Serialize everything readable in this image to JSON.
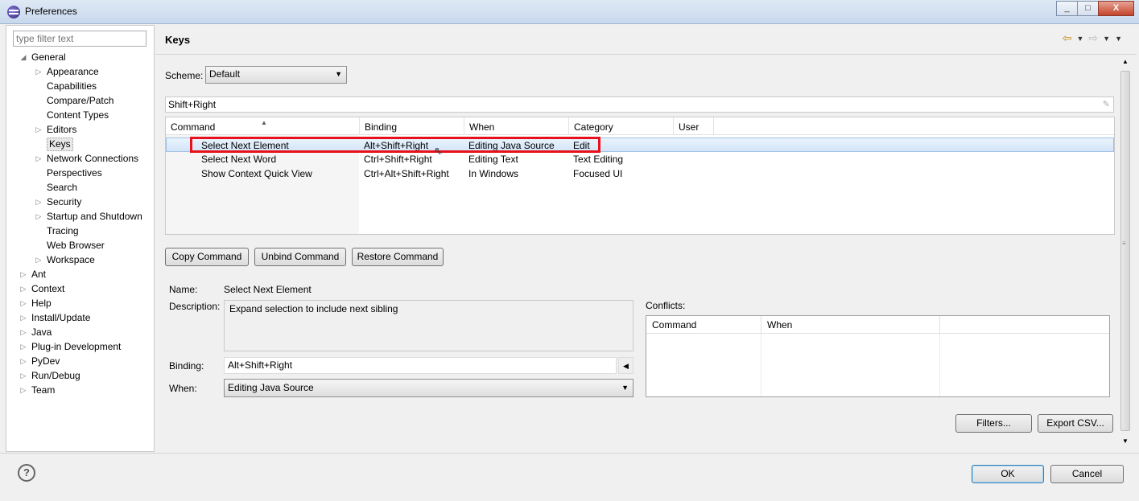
{
  "window": {
    "title": "Preferences",
    "min": "_",
    "max": "□",
    "close": "X"
  },
  "filter": {
    "placeholder": "type filter text"
  },
  "tree": [
    {
      "label": "General",
      "level": 0,
      "arrow": "◢"
    },
    {
      "label": "Appearance",
      "level": 1,
      "arrow": "▷"
    },
    {
      "label": "Capabilities",
      "level": 1,
      "arrow": ""
    },
    {
      "label": "Compare/Patch",
      "level": 1,
      "arrow": ""
    },
    {
      "label": "Content Types",
      "level": 1,
      "arrow": ""
    },
    {
      "label": "Editors",
      "level": 1,
      "arrow": "▷"
    },
    {
      "label": "Keys",
      "level": 1,
      "arrow": "",
      "selected": true
    },
    {
      "label": "Network Connections",
      "level": 1,
      "arrow": "▷"
    },
    {
      "label": "Perspectives",
      "level": 1,
      "arrow": ""
    },
    {
      "label": "Search",
      "level": 1,
      "arrow": ""
    },
    {
      "label": "Security",
      "level": 1,
      "arrow": "▷"
    },
    {
      "label": "Startup and Shutdown",
      "level": 1,
      "arrow": "▷"
    },
    {
      "label": "Tracing",
      "level": 1,
      "arrow": ""
    },
    {
      "label": "Web Browser",
      "level": 1,
      "arrow": ""
    },
    {
      "label": "Workspace",
      "level": 1,
      "arrow": "▷"
    },
    {
      "label": "Ant",
      "level": 0,
      "arrow": "▷"
    },
    {
      "label": "Context",
      "level": 0,
      "arrow": "▷"
    },
    {
      "label": "Help",
      "level": 0,
      "arrow": "▷"
    },
    {
      "label": "Install/Update",
      "level": 0,
      "arrow": "▷"
    },
    {
      "label": "Java",
      "level": 0,
      "arrow": "▷"
    },
    {
      "label": "Plug-in Development",
      "level": 0,
      "arrow": "▷"
    },
    {
      "label": "PyDev",
      "level": 0,
      "arrow": "▷"
    },
    {
      "label": "Run/Debug",
      "level": 0,
      "arrow": "▷"
    },
    {
      "label": "Team",
      "level": 0,
      "arrow": "▷"
    }
  ],
  "page": {
    "title": "Keys"
  },
  "scheme": {
    "label": "Scheme:",
    "value": "Default"
  },
  "search": {
    "value": "Shift+Right"
  },
  "table": {
    "columns": [
      "Command",
      "Binding",
      "When",
      "Category",
      "User"
    ],
    "rows": [
      {
        "command": "Select Next Element",
        "binding": "Alt+Shift+Right",
        "when": "Editing Java Source",
        "category": "Edit",
        "user": "",
        "selected": true
      },
      {
        "command": "Select Next Word",
        "binding": "Ctrl+Shift+Right",
        "when": "Editing Text",
        "category": "Text Editing",
        "user": ""
      },
      {
        "command": "Show Context Quick View",
        "binding": "Ctrl+Alt+Shift+Right",
        "when": "In Windows",
        "category": "Focused UI",
        "user": ""
      }
    ]
  },
  "buttons": {
    "copy": "Copy Command",
    "unbind": "Unbind Command",
    "restore": "Restore Command",
    "filters": "Filters...",
    "export": "Export CSV...",
    "ok": "OK",
    "cancel": "Cancel"
  },
  "details": {
    "name_label": "Name:",
    "name_value": "Select Next Element",
    "desc_label": "Description:",
    "desc_value": "Expand selection to include next sibling",
    "binding_label": "Binding:",
    "binding_value": "Alt+Shift+Right",
    "when_label": "When:",
    "when_value": "Editing Java Source"
  },
  "conflicts": {
    "label": "Conflicts:",
    "columns": [
      "Command",
      "When"
    ]
  },
  "help": {
    "glyph": "?"
  },
  "colors": {
    "highlight": "#e8101b",
    "selection": "#d3e5f8"
  }
}
